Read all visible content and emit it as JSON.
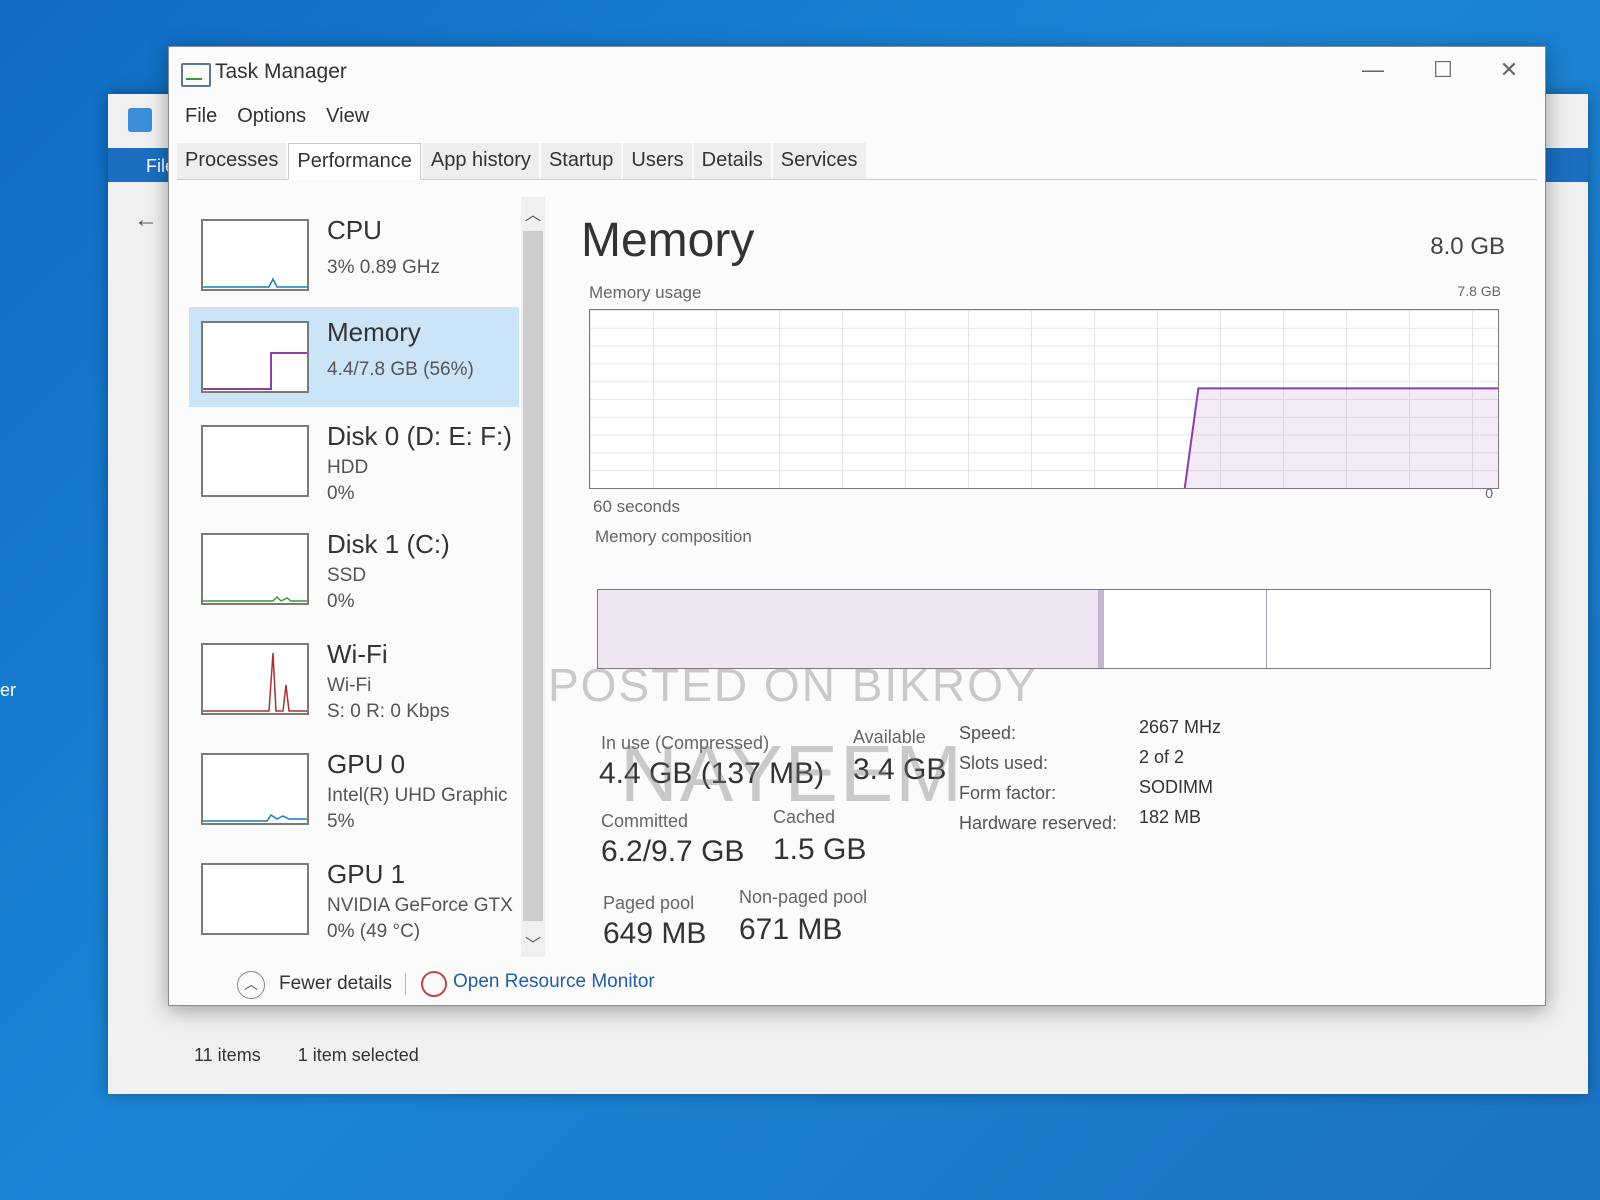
{
  "background": {
    "explorer_file_label": "File",
    "status_items": "11 items",
    "status_selected": "1 item selected",
    "left_edge_text": "er"
  },
  "window": {
    "title": "Task Manager",
    "minimize": "—",
    "maximize": "☐",
    "close": "✕"
  },
  "menu": {
    "file": "File",
    "options": "Options",
    "view": "View"
  },
  "tabs": [
    "Processes",
    "Performance",
    "App history",
    "Startup",
    "Users",
    "Details",
    "Services"
  ],
  "active_tab": "Performance",
  "resources": [
    {
      "name": "CPU",
      "line1": "3% 0.89 GHz",
      "line2": ""
    },
    {
      "name": "Memory",
      "line1": "4.4/7.8 GB (56%)",
      "line2": ""
    },
    {
      "name": "Disk 0 (D: E: F:)",
      "line1": "HDD",
      "line2": "0%"
    },
    {
      "name": "Disk 1 (C:)",
      "line1": "SSD",
      "line2": "0%"
    },
    {
      "name": "Wi-Fi",
      "line1": "Wi-Fi",
      "line2": "S: 0 R: 0 Kbps"
    },
    {
      "name": "GPU 0",
      "line1": "Intel(R) UHD Graphic",
      "line2": "5%"
    },
    {
      "name": "GPU 1",
      "line1": "NVIDIA GeForce GTX",
      "line2": "0% (49 °C)"
    }
  ],
  "memory": {
    "title": "Memory",
    "total": "8.0 GB",
    "usage_label": "Memory usage",
    "usage_max": "7.8 GB",
    "time_span": "60 seconds",
    "usage_min": "0",
    "composition_label": "Memory composition",
    "in_use_label": "In use (Compressed)",
    "in_use_value": "4.4 GB (137 MB)",
    "available_label": "Available",
    "available_value": "3.4 GB",
    "committed_label": "Committed",
    "committed_value": "6.2/9.7 GB",
    "cached_label": "Cached",
    "cached_value": "1.5 GB",
    "paged_label": "Paged pool",
    "paged_value": "649 MB",
    "nonpaged_label": "Non-paged pool",
    "nonpaged_value": "671 MB",
    "specs": [
      {
        "label": "Speed:",
        "value": "2667 MHz"
      },
      {
        "label": "Slots used:",
        "value": "2 of 2"
      },
      {
        "label": "Form factor:",
        "value": "SODIMM"
      },
      {
        "label": "Hardware reserved:",
        "value": "182 MB"
      }
    ],
    "usage_fraction": 0.56
  },
  "footer": {
    "fewer_details": "Fewer details",
    "open_resource_monitor": "Open Resource Monitor"
  },
  "watermark": {
    "line1": "POSTED ON BIKROY",
    "line2": "NAYEEM"
  },
  "colors": {
    "accent": "#1f5fa8",
    "selected_bg": "#cce4f7",
    "memory_purple": "#8b3fa7",
    "wifi_red": "#a83232"
  }
}
